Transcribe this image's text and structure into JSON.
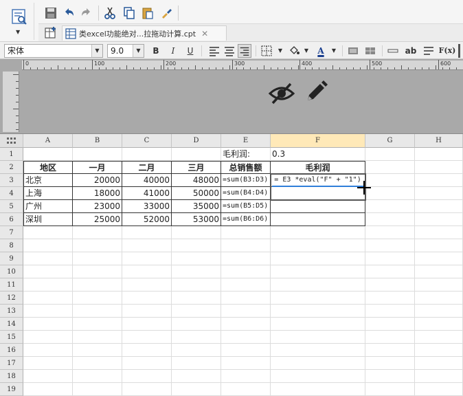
{
  "tab": {
    "title": "类excel功能绝对...拉拖动计算.cpt",
    "close": "✕"
  },
  "font": {
    "name": "宋体",
    "size": "9.0"
  },
  "format_buttons": {
    "bold": "B",
    "italic": "I",
    "underline": "U",
    "text_color": "A",
    "wrap": "ab",
    "fx": "F(x)"
  },
  "ruler": [
    "0",
    "100",
    "200",
    "300",
    "400",
    "500",
    "600"
  ],
  "columns": [
    "A",
    "B",
    "C",
    "D",
    "E",
    "F",
    "G",
    "H"
  ],
  "rows": [
    "1",
    "2",
    "3",
    "4",
    "5",
    "6",
    "7",
    "8",
    "9",
    "10",
    "11",
    "12",
    "13",
    "14",
    "15",
    "16",
    "17",
    "18",
    "19"
  ],
  "cells": {
    "E1": "毛利润:",
    "F1": "0.3",
    "headers": [
      "地区",
      "一月",
      "二月",
      "三月",
      "总销售额",
      "毛利润"
    ],
    "data": [
      {
        "region": "北京",
        "jan": "20000",
        "feb": "40000",
        "mar": "48000",
        "total": "=sum(B3:D3)",
        "profit": "= E3 *eval(\"F\" + \"1\")"
      },
      {
        "region": "上海",
        "jan": "18000",
        "feb": "41000",
        "mar": "50000",
        "total": "=sum(B4:D4)",
        "profit": ""
      },
      {
        "region": "广州",
        "jan": "23000",
        "feb": "33000",
        "mar": "35000",
        "total": "=sum(B5:D5)",
        "profit": ""
      },
      {
        "region": "深圳",
        "jan": "25000",
        "feb": "52000",
        "mar": "53000",
        "total": "=sum(B6:D6)",
        "profit": ""
      }
    ]
  },
  "colors": {
    "selected_column": "#ffe9b8",
    "selection_underline": "#2f7fd9",
    "design_area": "#a9a9a9"
  },
  "icons": [
    "preview-icon",
    "save-icon",
    "undo-icon",
    "redo-icon",
    "cut-icon",
    "copy-icon",
    "paste-icon",
    "format-painter-icon",
    "add-tab-icon",
    "report-icon",
    "hidden-eye-icon",
    "edit-pencil-icon"
  ]
}
